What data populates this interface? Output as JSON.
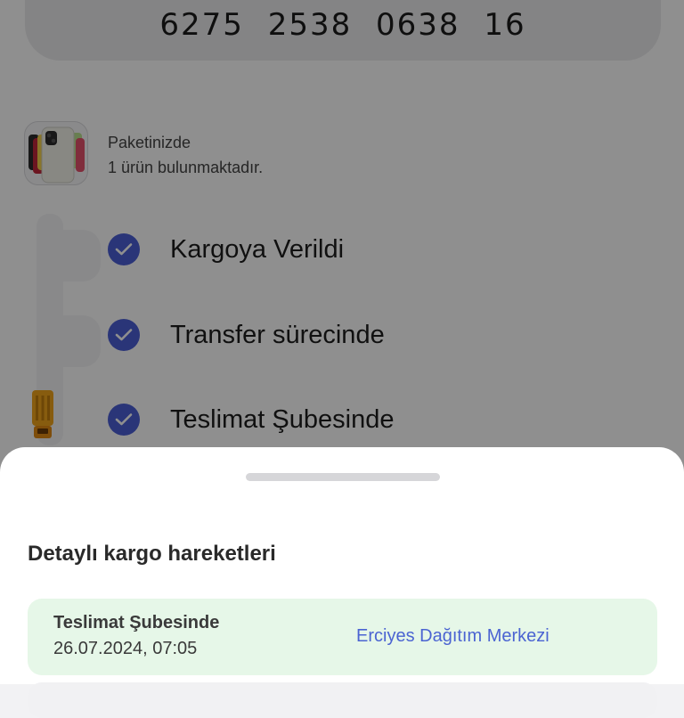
{
  "tracking": {
    "number": "6275  2538  0638  16"
  },
  "package": {
    "line1": "Paketinizde",
    "line2": "1 ürün bulunmaktadır."
  },
  "steps": [
    {
      "label": "Kargoya Verildi",
      "done": true
    },
    {
      "label": "Transfer sürecinde",
      "done": true
    },
    {
      "label": "Teslimat Şubesinde",
      "done": true
    }
  ],
  "sheet": {
    "title": "Detaylı kargo hareketleri",
    "movements": [
      {
        "status": "Teslimat Şubesinde",
        "datetime": "26.07.2024, 07:05",
        "location": "Erciyes Dağıtım Merkezi"
      }
    ]
  },
  "colors": {
    "accent": "#4b5fd6",
    "card_green": "#e6f7e8",
    "link": "#4b64d2"
  }
}
